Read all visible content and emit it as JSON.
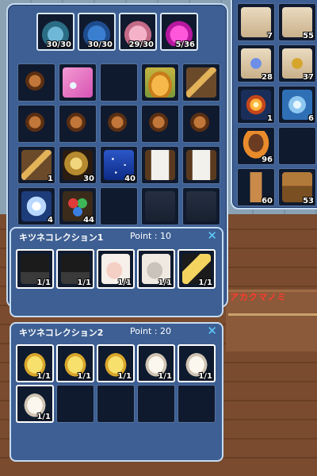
{
  "background": {
    "floor_text": "アカクマノミ"
  },
  "inventory": {
    "top_row": [
      {
        "icon": "blue-bag-icon",
        "count": "30/30"
      },
      {
        "icon": "blue-bag-icon",
        "count": "30/30"
      },
      {
        "icon": "pink-bag-icon",
        "count": "29/30"
      },
      {
        "icon": "magenta-bag-icon",
        "count": "5/36"
      }
    ],
    "slots": [
      {
        "icon": "earring-icon",
        "count": ""
      },
      {
        "icon": "pink-item-icon",
        "count": ""
      },
      {
        "icon": "empty",
        "count": ""
      },
      {
        "icon": "fox-item-icon",
        "count": ""
      },
      {
        "icon": "flute-icon",
        "count": ""
      },
      {
        "icon": "earring-icon",
        "count": ""
      },
      {
        "icon": "earring-icon",
        "count": ""
      },
      {
        "icon": "earring-icon",
        "count": ""
      },
      {
        "icon": "earring-icon",
        "count": ""
      },
      {
        "icon": "earring-icon",
        "count": ""
      },
      {
        "icon": "flute-icon",
        "count": "1"
      },
      {
        "icon": "gold-orb-icon",
        "count": "30"
      },
      {
        "icon": "stars-icon",
        "count": "40"
      },
      {
        "icon": "white-robe-icon",
        "count": ""
      },
      {
        "icon": "white-robe-icon",
        "count": ""
      },
      {
        "icon": "diamond-icon",
        "count": "4"
      },
      {
        "icon": "gems-icon",
        "count": "44"
      },
      {
        "icon": "empty",
        "count": ""
      },
      {
        "icon": "locked-fox-icon",
        "count": ""
      },
      {
        "icon": "locked-fox-icon",
        "count": ""
      }
    ],
    "side_slots": [
      {
        "icon": "scroll-icon",
        "count": "7"
      },
      {
        "icon": "scroll-icon",
        "count": "55"
      },
      {
        "icon": "scroll-blue-icon",
        "count": "28"
      },
      {
        "icon": "scroll-gold-icon",
        "count": "37"
      },
      {
        "icon": "sun-icon",
        "count": "1"
      },
      {
        "icon": "snowflake-icon",
        "count": "6"
      },
      {
        "icon": "food-bowl-icon",
        "count": "96"
      },
      {
        "icon": "empty",
        "count": ""
      },
      {
        "icon": "crystal-icon",
        "count": "60"
      },
      {
        "icon": "treasure-chest-icon",
        "count": "53"
      }
    ]
  },
  "collection1": {
    "title": "キツネコレクション1",
    "point": "Point : 10",
    "close": "✕",
    "slots": [
      {
        "icon": "shorts-icon",
        "count": "1/1"
      },
      {
        "icon": "shorts-icon",
        "count": "1/1"
      },
      {
        "icon": "pink-glove-icon",
        "count": "1/1"
      },
      {
        "icon": "grey-glove-icon",
        "count": "1/1"
      },
      {
        "icon": "golden-tails-icon",
        "count": "1/1"
      }
    ]
  },
  "collection2": {
    "title": "キツネコレクション2",
    "point": "Point : 20",
    "close": "✕",
    "slots": [
      {
        "icon": "yellow-fox-icon",
        "count": "1/1"
      },
      {
        "icon": "yellow-fox-icon",
        "count": "1/1"
      },
      {
        "icon": "yellow-fox-icon",
        "count": "1/1"
      },
      {
        "icon": "white-fox-icon",
        "count": "1/1"
      },
      {
        "icon": "white-fox-icon",
        "count": "1/1"
      },
      {
        "icon": "white-fox-icon",
        "count": "1/1"
      },
      {
        "icon": "empty",
        "count": ""
      },
      {
        "icon": "empty",
        "count": ""
      },
      {
        "icon": "empty",
        "count": ""
      },
      {
        "icon": "empty",
        "count": ""
      }
    ]
  },
  "colors": {
    "panel": "#3d5f93",
    "panel_border": "#c6dcf2",
    "close": "#5fd0ff",
    "floor_text": "#ff3b2e"
  }
}
